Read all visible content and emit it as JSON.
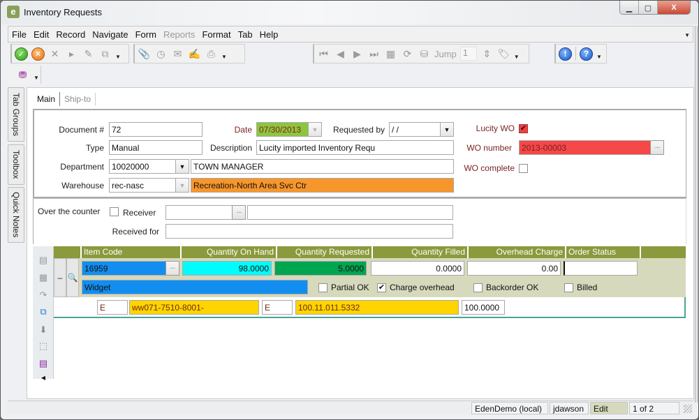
{
  "window": {
    "title": "Inventory Requests",
    "app_icon_letter": "e",
    "controls": {
      "minimize": "▭",
      "maximize": "◻",
      "close": "X"
    }
  },
  "menubar": {
    "items": [
      {
        "label": "File",
        "enabled": true
      },
      {
        "label": "Edit",
        "enabled": true
      },
      {
        "label": "Record",
        "enabled": true
      },
      {
        "label": "Navigate",
        "enabled": true
      },
      {
        "label": "Form",
        "enabled": true
      },
      {
        "label": "Reports",
        "enabled": false
      },
      {
        "label": "Format",
        "enabled": true
      },
      {
        "label": "Tab",
        "enabled": true
      },
      {
        "label": "Help",
        "enabled": true
      }
    ]
  },
  "toolbar": {
    "record_icons": [
      "save-icon",
      "cancel-icon",
      "delete-icon",
      "insert-icon",
      "edit-icon",
      "filter-icon"
    ],
    "tools_icons": [
      "attachment-icon",
      "clock-icon",
      "email-icon",
      "notes-icon",
      "print-icon"
    ],
    "nav_icons": [
      "first-icon",
      "previous-icon",
      "next-icon",
      "last-icon",
      "grid-view-icon",
      "refresh-icon",
      "hierarchy-icon"
    ],
    "jump_label": "Jump",
    "jump_value": "1",
    "help_icons": [
      "info-icon",
      "help-icon"
    ]
  },
  "side_tabs": [
    "Tab Groups",
    "Toolbox",
    "Quick Notes"
  ],
  "tabs": [
    {
      "label": "Main",
      "active": true
    },
    {
      "label": "Ship-to",
      "active": false
    }
  ],
  "form": {
    "document_label": "Document #",
    "document_value": "72",
    "type_label": "Type",
    "type_value": "Manual",
    "department_label": "Department",
    "department_code": "10020000",
    "department_name": "TOWN MANAGER",
    "warehouse_label": "Warehouse",
    "warehouse_code": "rec-nasc",
    "warehouse_name": "Recreation-North Area Svc Ctr",
    "date_label": "Date",
    "date_value": "07/30/2013",
    "requested_by_label": "Requested by",
    "requested_by_value": " / /",
    "description_label": "Description",
    "description_value": "Lucity imported Inventory Requ",
    "lucity_wo_label": "Lucity WO",
    "lucity_wo_checked": true,
    "wo_number_label": "WO number",
    "wo_number_value": "2013-00003",
    "wo_complete_label": "WO complete",
    "wo_complete_checked": false,
    "over_counter_label": "Over the counter",
    "over_counter_checked": false,
    "receiver_label": "Receiver",
    "receiver_value": "",
    "receiver_name": "",
    "received_for_label": "Received for",
    "received_for_value": ""
  },
  "grid": {
    "columns": [
      "Item Code",
      "Quantity On Hand",
      "Quantity Requested",
      "Quantity Filled",
      "Overhead Charge",
      "Order Status",
      ""
    ],
    "row": {
      "item_code": "16959",
      "qty_on_hand": "98.0000",
      "qty_requested": "5.0000",
      "qty_filled": "0.0000",
      "overhead_charge": "0.00",
      "order_status": "",
      "description": "Widget",
      "partial_ok_label": "Partial OK",
      "partial_ok": false,
      "charge_overhead_label": "Charge overhead",
      "charge_overhead": true,
      "backorder_ok_label": "Backorder OK",
      "backorder_ok": false,
      "billed_label": "Billed",
      "billed": false,
      "collapse_symbol": "–"
    },
    "account_row": {
      "type1": "E",
      "account1": "ww071-7510-8001-",
      "type2": "E",
      "account2": "100.11.011.5332",
      "percent": "100.0000"
    }
  },
  "left_tools": [
    "grid-add-icon",
    "grid-icon",
    "redo-icon",
    "network-icon",
    "move-down-icon",
    "box-icon",
    "report-icon",
    "collapse-left-icon"
  ],
  "status_bar": {
    "database": "EdenDemo (local)",
    "user": "jdawson",
    "mode": "Edit",
    "record_position": "1 of 2"
  },
  "colors": {
    "grid_header": "#8a9a3c",
    "grid_body": "#d7d9bd",
    "date_field": "#8cc63e",
    "warehouse_name": "#f7962b",
    "wo_number": "#f54848",
    "item_code": "#118ef0",
    "qty_on_hand": "#00fcfc",
    "qty_requested": "#00a550",
    "account": "#ffd400"
  }
}
